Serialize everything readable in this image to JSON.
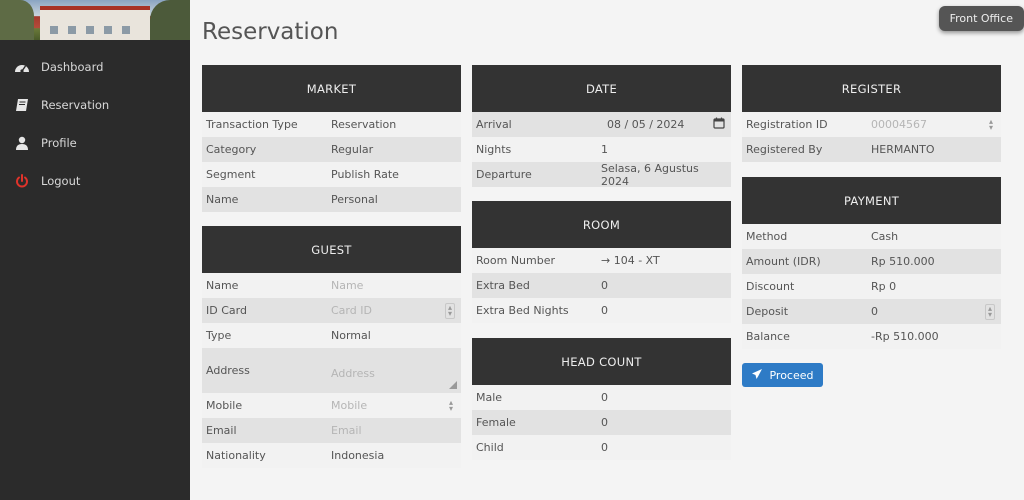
{
  "sidebar": {
    "items": [
      {
        "label": "Dashboard",
        "icon": "dashboard-icon"
      },
      {
        "label": "Reservation",
        "icon": "book-icon"
      },
      {
        "label": "Profile",
        "icon": "user-icon"
      },
      {
        "label": "Logout",
        "icon": "power-icon"
      }
    ]
  },
  "header": {
    "title": "Reservation",
    "front_office_label": "Front Office"
  },
  "market": {
    "heading": "MARKET",
    "rows": [
      {
        "label": "Transaction Type",
        "value": "Reservation"
      },
      {
        "label": "Category",
        "value": "Regular"
      },
      {
        "label": "Segment",
        "value": "Publish Rate"
      },
      {
        "label": "Name",
        "value": "Personal"
      }
    ]
  },
  "guest": {
    "heading": "GUEST",
    "name_label": "Name",
    "name_placeholder": "Name",
    "idcard_label": "ID Card",
    "idcard_placeholder": "Card ID",
    "type_label": "Type",
    "type_value": "Normal",
    "address_label": "Address",
    "address_placeholder": "Address",
    "mobile_label": "Mobile",
    "mobile_placeholder": "Mobile",
    "email_label": "Email",
    "email_placeholder": "Email",
    "nationality_label": "Nationality",
    "nationality_value": "Indonesia"
  },
  "date": {
    "heading": "DATE",
    "arrival_label": "Arrival",
    "arrival_value": "08 / 05 / 2024",
    "nights_label": "Nights",
    "nights_value": "1",
    "departure_label": "Departure",
    "departure_value": "Selasa, 6 Agustus 2024"
  },
  "room": {
    "heading": "ROOM",
    "rows": [
      {
        "label": "Room Number",
        "value": "→ 104 - XT"
      },
      {
        "label": "Extra Bed",
        "value": "0"
      },
      {
        "label": "Extra Bed Nights",
        "value": "0"
      }
    ]
  },
  "headcount": {
    "heading": "HEAD COUNT",
    "rows": [
      {
        "label": "Male",
        "value": "0"
      },
      {
        "label": "Female",
        "value": "0"
      },
      {
        "label": "Child",
        "value": "0"
      }
    ]
  },
  "register": {
    "heading": "REGISTER",
    "regid_label": "Registration ID",
    "regid_value": "00004567",
    "regby_label": "Registered By",
    "regby_value": "HERMANTO"
  },
  "payment": {
    "heading": "PAYMENT",
    "method_label": "Method",
    "method_value": "Cash",
    "amount_label": "Amount (IDR)",
    "amount_value": "Rp 510.000",
    "discount_label": "Discount",
    "discount_value": "Rp 0",
    "deposit_label": "Deposit",
    "deposit_value": "0",
    "balance_label": "Balance",
    "balance_value": "-Rp 510.000"
  },
  "actions": {
    "proceed_label": "Proceed"
  },
  "colors": {
    "sidebar_bg": "#2b2b2b",
    "panel_header": "#333333",
    "accent_blue": "#2e7bc6",
    "logout_red": "#e0332b"
  }
}
